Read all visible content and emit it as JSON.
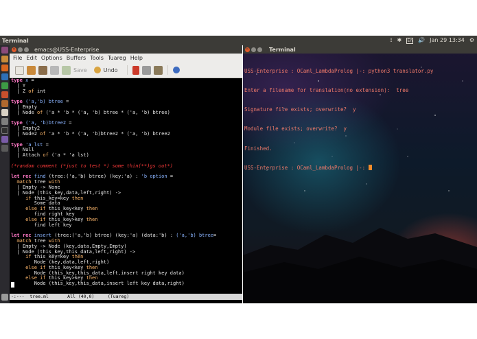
{
  "top_panel": {
    "title": "Terminal",
    "indicators": {
      "wifi": "⟟",
      "bluetooth": "✱",
      "keyboard": "En",
      "sound": "🔊",
      "clock": "Jan 29 13:34",
      "gear": "⚙"
    }
  },
  "emacs": {
    "window_title": "emacs@USS-Enterprise",
    "menu": [
      "File",
      "Edit",
      "Options",
      "Buffers",
      "Tools",
      "Tuareg",
      "Help"
    ],
    "toolbar": {
      "save_label": "Save",
      "undo_label": "Undo"
    },
    "modeline": "-:---  tree.ml       All (40,0)     (Tuareg)"
  },
  "terminal": {
    "window_title": "Terminal",
    "lines": [
      "USS-Enterprise : OCaml_LambdaProlog |-: python3 translator.py",
      "Enter a filename for translation(no extension):  tree",
      "Signature file exists; overwrite?  y",
      "Module file exists; overwrite?  y",
      "Finished.",
      "USS-Enterprise : OCaml_LambdaProlog |-: "
    ]
  },
  "colors": {
    "panel": "#3c3b37",
    "launcher": "#2b2a2f",
    "keyword": "#ff79c6",
    "comment": "#ff3b3b",
    "terminal_text": "#f07a6a",
    "cursor": "#f28b2a"
  }
}
